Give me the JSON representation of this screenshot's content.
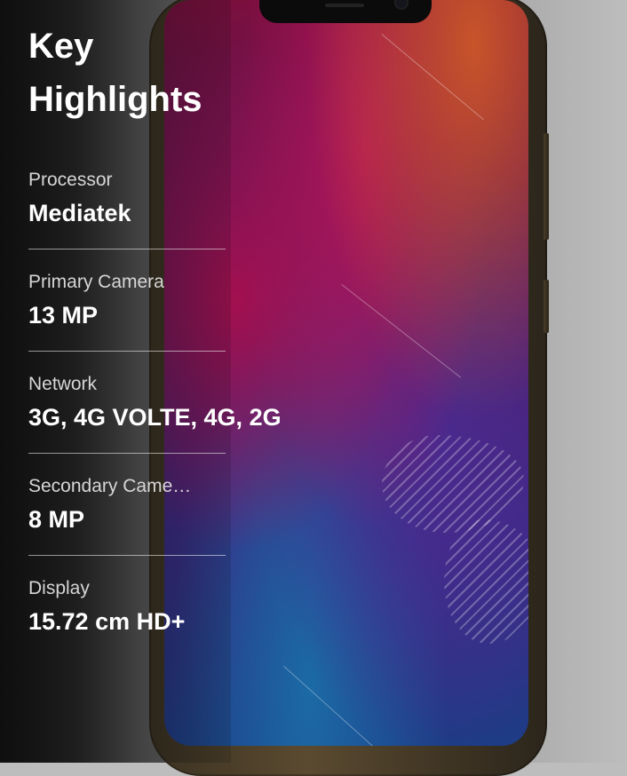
{
  "heading": {
    "line1": "Key",
    "line2": "Highlights"
  },
  "specs": [
    {
      "label": "Processor",
      "value": "Mediatek"
    },
    {
      "label": "Primary Camera",
      "value": "13 MP"
    },
    {
      "label": "Network",
      "value": "3G, 4G VOLTE, 4G, 2G"
    },
    {
      "label": "Secondary Came…",
      "value": "8 MP"
    },
    {
      "label": "Display",
      "value": "15.72 cm HD+"
    }
  ],
  "colors": {
    "text_primary": "#ffffff",
    "text_secondary": "#d6d6d6",
    "phone_frame": "#5a4a30"
  },
  "image": {
    "subject": "smartphone-product-image"
  }
}
